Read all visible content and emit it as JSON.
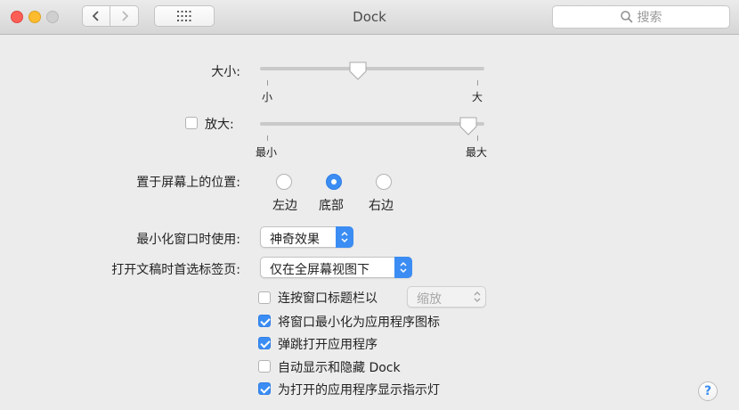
{
  "window": {
    "title": "Dock"
  },
  "toolbar": {
    "search_placeholder": "搜索"
  },
  "size": {
    "label": "大小:",
    "value": 0.43,
    "min_label": "小",
    "max_label": "大"
  },
  "magnification": {
    "label": "放大:",
    "checked": false,
    "value": 0.97,
    "min_label": "最小",
    "max_label": "最大"
  },
  "position": {
    "label": "置于屏幕上的位置:",
    "options": [
      "左边",
      "底部",
      "右边"
    ],
    "selected": "底部"
  },
  "minimize_effect": {
    "label": "最小化窗口时使用:",
    "value": "神奇效果"
  },
  "prefer_tabs": {
    "label": "打开文稿时首选标签页:",
    "value": "仅在全屏幕视图下"
  },
  "checkboxes": [
    {
      "label": "连按窗口标题栏以",
      "checked": false
    },
    {
      "label": "将窗口最小化为应用程序图标",
      "checked": true
    },
    {
      "label": "弹跳打开应用程序",
      "checked": true
    },
    {
      "label": "自动显示和隐藏 Dock",
      "checked": false
    },
    {
      "label": "为打开的应用程序显示指示灯",
      "checked": true
    }
  ],
  "double_click_action": {
    "value": "缩放"
  },
  "help": {
    "label": "?"
  },
  "colors": {
    "accent": "#3b8df3"
  }
}
